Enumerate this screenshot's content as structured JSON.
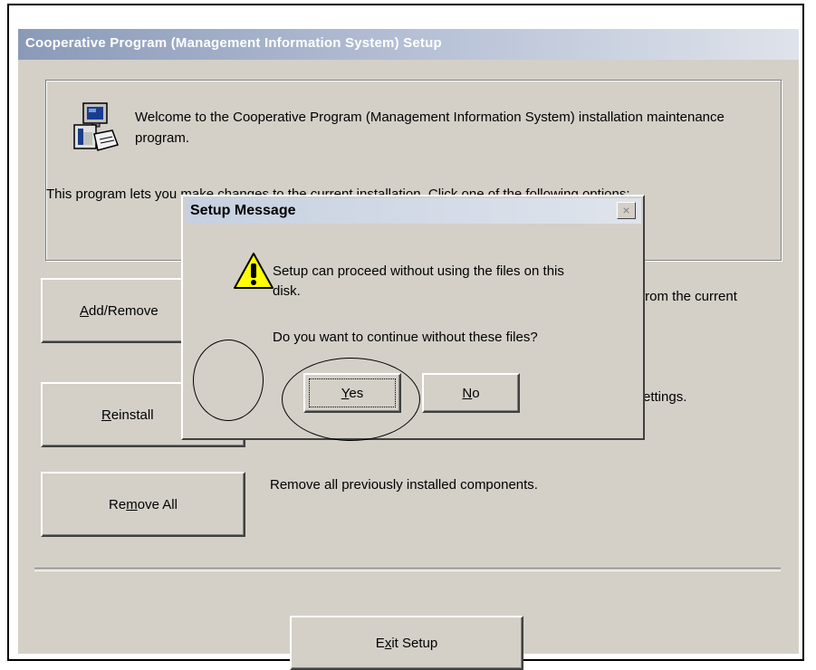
{
  "window": {
    "title": "Cooperative Program (Management Information System) Setup",
    "welcome_text": "Welcome to the Cooperative Program (Management Information System) installation maintenance program.",
    "intro_text": "This program lets you make changes to the current installation. Click one of the following options:"
  },
  "options": [
    {
      "label": "Add/Remove",
      "hotkey": "A",
      "description": "from the current"
    },
    {
      "label": "Reinstall",
      "hotkey": "R",
      "description": "ettings."
    },
    {
      "label": "Remove All",
      "hotkey": "m",
      "description": "Remove all previously installed components."
    }
  ],
  "exit_button": {
    "label": "Exit Setup",
    "hotkey": "x"
  },
  "dialog": {
    "title": "Setup Message",
    "message_line1": "Setup can proceed without using the files on this",
    "message_line2": "disk.",
    "question": "Do you want to continue without these files?",
    "yes_label": "Yes",
    "no_label": "No",
    "icon": "warning-icon"
  },
  "colors": {
    "face": "#d4d0c8",
    "title_gradient_start": "#8a9ab8",
    "warning_yellow": "#ffff00"
  }
}
